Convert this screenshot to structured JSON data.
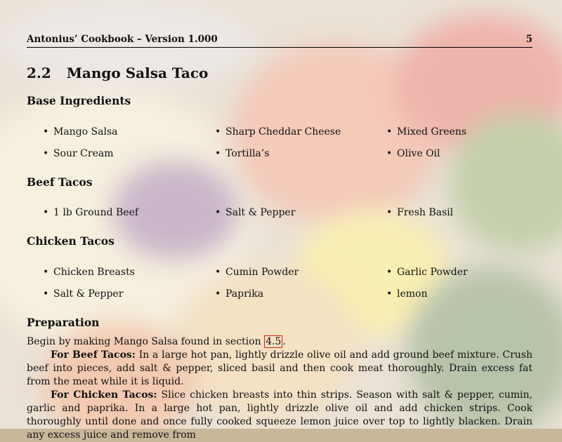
{
  "header": {
    "title": "Antonius’ Cookbook – Version 1.000",
    "page": "5"
  },
  "section": {
    "number": "2.2",
    "title": "Mango Salsa Taco"
  },
  "groups": [
    {
      "heading": "Base Ingredients",
      "items": [
        "Mango Salsa",
        "Sharp Cheddar Cheese",
        "Mixed Greens",
        "Sour Cream",
        "Tortilla’s",
        "Olive Oil"
      ]
    },
    {
      "heading": "Beef Tacos",
      "items": [
        "1 lb Ground Beef",
        "Salt & Pepper",
        "Fresh Basil"
      ]
    },
    {
      "heading": "Chicken Tacos",
      "items": [
        "Chicken Breasts",
        "Cumin Powder",
        "Garlic Powder",
        "Salt & Pepper",
        "Paprika",
        "lemon"
      ]
    }
  ],
  "preparation": {
    "heading": "Preparation",
    "intro": "Begin by making Mango Salsa found in section",
    "intro_ref": "4.5",
    "intro_end": ".",
    "beef_label": "For Beef Tacos:",
    "beef_text": "In a large hot pan, lightly drizzle olive oil and add ground beef mixture. Crush beef into pieces, add salt & pepper, sliced basil and then cook meat thoroughly. Drain excess fat from the meat while it is liquid.",
    "chicken_label": "For Chicken Tacos:",
    "chicken_text": "Slice chicken breasts into thin strips. Season with salt & pepper, cumin, garlic and paprika. In a large hot pan, lightly drizzle olive oil and add chicken strips. Cook thoroughly until done and once fully cooked squeeze lemon juice over top to lightly blacken. Drain any excess juice and remove from"
  },
  "colors": {
    "reference_box": "#d21111"
  }
}
